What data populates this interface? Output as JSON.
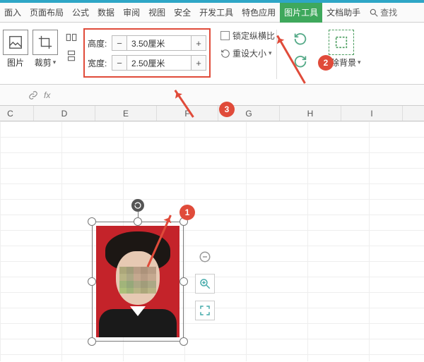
{
  "menubar": {
    "items": [
      "面入",
      "页面布局",
      "公式",
      "数据",
      "审阅",
      "视图",
      "安全",
      "开发工具",
      "特色应用",
      "图片工具",
      "文档助手"
    ],
    "active_index": 9,
    "search_label": "查找"
  },
  "ribbon": {
    "picture_label": "图片",
    "crop_label": "裁剪",
    "size": {
      "height_label": "高度:",
      "height_value": "3.50厘米",
      "width_label": "宽度:",
      "width_value": "2.50厘米",
      "minus": "−",
      "plus": "+"
    },
    "lock_aspect_label": "锁定纵横比",
    "reset_size_label": "重设大小",
    "remove_bg_label": "抠除背景"
  },
  "formula_bar": {
    "fx": "fx"
  },
  "columns": [
    "C",
    "D",
    "E",
    "F",
    "G",
    "H",
    "I"
  ],
  "badges": {
    "b1": "1",
    "b2": "2",
    "b3": "3"
  },
  "float": {
    "zoom_tip": "zoom",
    "fullscreen_tip": "fullscreen"
  }
}
